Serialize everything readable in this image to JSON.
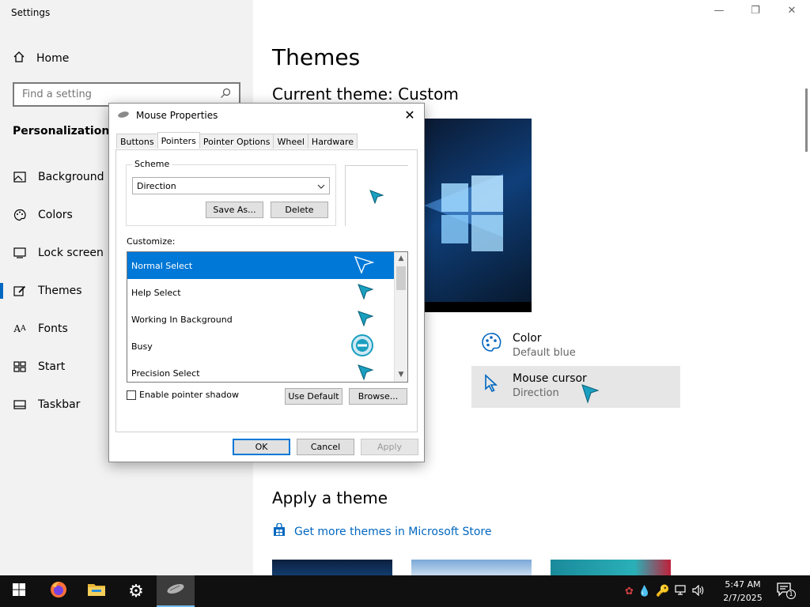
{
  "settings": {
    "title": "Settings",
    "home_label": "Home",
    "search_placeholder": "Find a setting",
    "section_title": "Personalization",
    "nav": [
      {
        "label": "Background",
        "icon": "picture-icon"
      },
      {
        "label": "Colors",
        "icon": "palette-icon"
      },
      {
        "label": "Lock screen",
        "icon": "lock-screen-icon"
      },
      {
        "label": "Themes",
        "icon": "brush-icon",
        "selected": true
      },
      {
        "label": "Fonts",
        "icon": "font-icon"
      },
      {
        "label": "Start",
        "icon": "start-grid-icon"
      },
      {
        "label": "Taskbar",
        "icon": "taskbar-icon"
      }
    ]
  },
  "themes": {
    "title": "Themes",
    "current_theme": "Current theme: Custom",
    "color_label": "Color",
    "color_value": "Default blue",
    "cursor_label": "Mouse cursor",
    "cursor_value": "Direction",
    "apply_title": "Apply a theme",
    "store_link": "Get more themes in Microsoft Store"
  },
  "dialog": {
    "title": "Mouse Properties",
    "tabs": [
      "Buttons",
      "Pointers",
      "Pointer Options",
      "Wheel",
      "Hardware"
    ],
    "active_tab": "Pointers",
    "scheme_label": "Scheme",
    "scheme_value": "Direction",
    "save_as": "Save As...",
    "delete": "Delete",
    "customize_label": "Customize:",
    "pointers": [
      {
        "name": "Normal Select",
        "selected": true
      },
      {
        "name": "Help Select"
      },
      {
        "name": "Working In Background"
      },
      {
        "name": "Busy"
      },
      {
        "name": "Precision Select"
      }
    ],
    "shadow_label": "Enable pointer shadow",
    "use_default": "Use Default",
    "browse": "Browse...",
    "ok": "OK",
    "cancel": "Cancel",
    "apply": "Apply"
  },
  "taskbar": {
    "time": "5:47 AM",
    "date": "2/7/2025",
    "notification_count": "1"
  },
  "colors": {
    "accent": "#0067c0",
    "list_selection": "#0078d7",
    "cursor_teal": "#1a9fc0"
  }
}
